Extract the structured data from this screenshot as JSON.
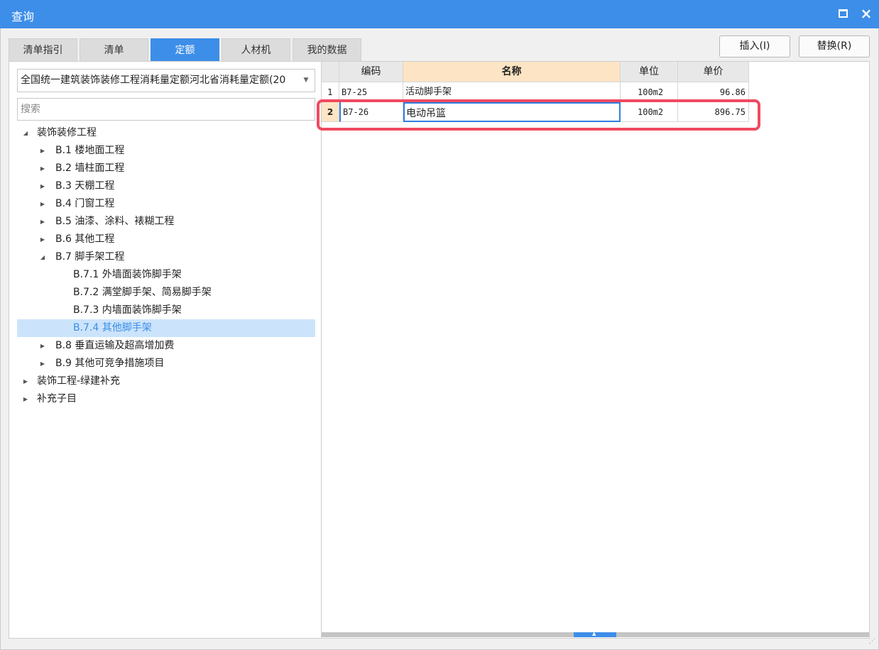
{
  "window": {
    "title": "查询",
    "maximize_icon": "maximize-icon",
    "close_icon": "close-icon",
    "close_glyph": "×"
  },
  "tabs": [
    {
      "label": "清单指引",
      "active": false
    },
    {
      "label": "清单",
      "active": false
    },
    {
      "label": "定额",
      "active": true
    },
    {
      "label": "人材机",
      "active": false
    },
    {
      "label": "我的数据",
      "active": false
    }
  ],
  "actions": {
    "insert_label": "插入(I)",
    "replace_label": "替换(R)"
  },
  "library": {
    "selected": "全国统一建筑装饰装修工程消耗量定额河北省消耗量定额(20",
    "dropdown_icon": "dropdown-arrow-icon"
  },
  "search": {
    "placeholder": "搜索"
  },
  "tree": [
    {
      "label": "装饰装修工程",
      "level": 0,
      "toggle": "expanded"
    },
    {
      "label": "B.1 楼地面工程",
      "level": 1,
      "toggle": "collapsed"
    },
    {
      "label": "B.2 墙柱面工程",
      "level": 1,
      "toggle": "collapsed"
    },
    {
      "label": "B.3 天棚工程",
      "level": 1,
      "toggle": "collapsed"
    },
    {
      "label": "B.4 门窗工程",
      "level": 1,
      "toggle": "collapsed"
    },
    {
      "label": "B.5 油漆、涂料、裱糊工程",
      "level": 1,
      "toggle": "collapsed"
    },
    {
      "label": "B.6 其他工程",
      "level": 1,
      "toggle": "collapsed"
    },
    {
      "label": "B.7 脚手架工程",
      "level": 1,
      "toggle": "expanded"
    },
    {
      "label": "B.7.1 外墙面装饰脚手架",
      "level": 2,
      "toggle": "none"
    },
    {
      "label": "B.7.2 满堂脚手架、简易脚手架",
      "level": 2,
      "toggle": "none"
    },
    {
      "label": "B.7.3 内墙面装饰脚手架",
      "level": 2,
      "toggle": "none"
    },
    {
      "label": "B.7.4 其他脚手架",
      "level": 2,
      "toggle": "none",
      "selected": true
    },
    {
      "label": "B.8 垂直运输及超高增加费",
      "level": 1,
      "toggle": "collapsed"
    },
    {
      "label": "B.9 其他可竞争措施项目",
      "level": 1,
      "toggle": "collapsed"
    },
    {
      "label": "装饰工程-绿建补充",
      "level": 0,
      "toggle": "collapsed"
    },
    {
      "label": "补充子目",
      "level": 0,
      "toggle": "collapsed"
    }
  ],
  "grid": {
    "headers": {
      "code": "编码",
      "name": "名称",
      "unit": "单位",
      "price": "单价"
    },
    "rows": [
      {
        "index": "1",
        "code": "B7-25",
        "name": "活动脚手架",
        "unit": "100m2",
        "price": "96.86"
      },
      {
        "index": "2",
        "code": "B7-26",
        "name": "电动吊篮",
        "unit": "100m2",
        "price": "896.75",
        "current": true
      }
    ]
  },
  "colors": {
    "accent": "#3d8ee8",
    "highlight_border": "#ef4a60",
    "selected_row_bg": "#cce4fb",
    "name_header_bg": "#fde4c4"
  }
}
